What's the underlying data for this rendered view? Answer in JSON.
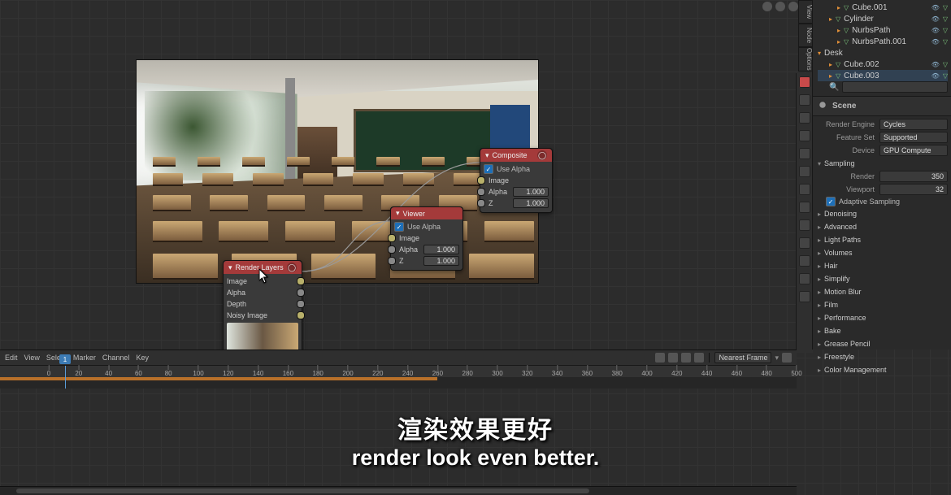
{
  "outliner": {
    "items": [
      {
        "name": "Cube.001",
        "indent": 2,
        "expandable": true
      },
      {
        "name": "Cylinder",
        "indent": 1,
        "expandable": true
      },
      {
        "name": "NurbsPath",
        "indent": 2,
        "expandable": true
      },
      {
        "name": "NurbsPath.001",
        "indent": 2,
        "expandable": true
      },
      {
        "name": "Desk",
        "indent": 0,
        "expandable": true,
        "open": true
      },
      {
        "name": "Cube.002",
        "indent": 1,
        "expandable": true
      },
      {
        "name": "Cube.003",
        "indent": 1,
        "expandable": true,
        "selected": true
      }
    ]
  },
  "scene": {
    "title": "Scene",
    "render_engine_label": "Render Engine",
    "render_engine": "Cycles",
    "feature_set_label": "Feature Set",
    "feature_set": "Supported",
    "device_label": "Device",
    "device": "GPU Compute"
  },
  "sampling": {
    "title": "Sampling",
    "render_label": "Render",
    "render": "350",
    "viewport_label": "Viewport",
    "viewport": "32",
    "adaptive": "Adaptive Sampling",
    "denoising": "Denoising",
    "advanced": "Advanced"
  },
  "sections": [
    "Light Paths",
    "Volumes",
    "Hair",
    "Simplify",
    "Motion Blur",
    "Film",
    "Performance",
    "Bake",
    "Grease Pencil",
    "Freestyle",
    "Color Management"
  ],
  "vert_tabs": [
    "View",
    "Node",
    "Options"
  ],
  "nodes": {
    "render_layers": {
      "title": "Render Layers",
      "outputs": [
        "Image",
        "Alpha",
        "Depth",
        "Noisy Image"
      ]
    },
    "composite": {
      "title": "Composite",
      "use_alpha": "Use Alpha",
      "image": "Image",
      "alpha_label": "Alpha",
      "alpha_value": "1.000",
      "z_label": "Z",
      "z_value": "1.000"
    },
    "viewer": {
      "title": "Viewer",
      "use_alpha": "Use Alpha",
      "image": "Image",
      "alpha_label": "Alpha",
      "alpha_value": "1.000",
      "z_label": "Z",
      "z_value": "1.000"
    }
  },
  "timeline": {
    "menu": [
      "Edit",
      "View",
      "Select",
      "Marker",
      "Channel",
      "Key"
    ],
    "snap_label": "Nearest Frame",
    "ticks": [
      "0",
      "20",
      "40",
      "60",
      "80",
      "100",
      "120",
      "140",
      "160",
      "180",
      "200",
      "220",
      "240",
      "260",
      "280",
      "300",
      "320",
      "340",
      "360",
      "380",
      "400",
      "420",
      "440",
      "460",
      "480",
      "500"
    ],
    "playhead": "1",
    "orange_end_pct": 52
  },
  "subtitles": {
    "cn": "渲染效果更好",
    "en": "render look even better."
  }
}
